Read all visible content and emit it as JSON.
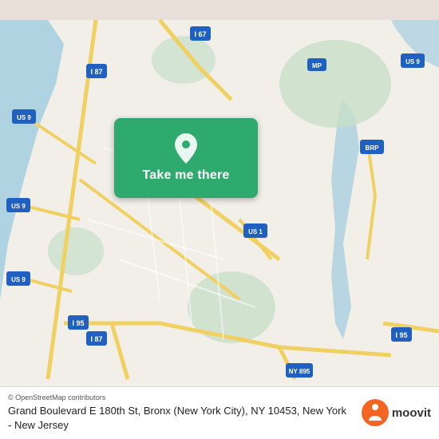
{
  "map": {
    "attribution": "© OpenStreetMap contributors",
    "center_label": "Grand Boulevard E 180th St, Bronx (New York City), NY 10453, New York - New Jersey"
  },
  "card": {
    "button_label": "Take me there"
  },
  "moovit": {
    "text": "moovit"
  },
  "address": {
    "line1": "Grand Boulevard E 180th St, Bronx (New York City),",
    "line2": "NY 10453, New York - New Jersey"
  }
}
